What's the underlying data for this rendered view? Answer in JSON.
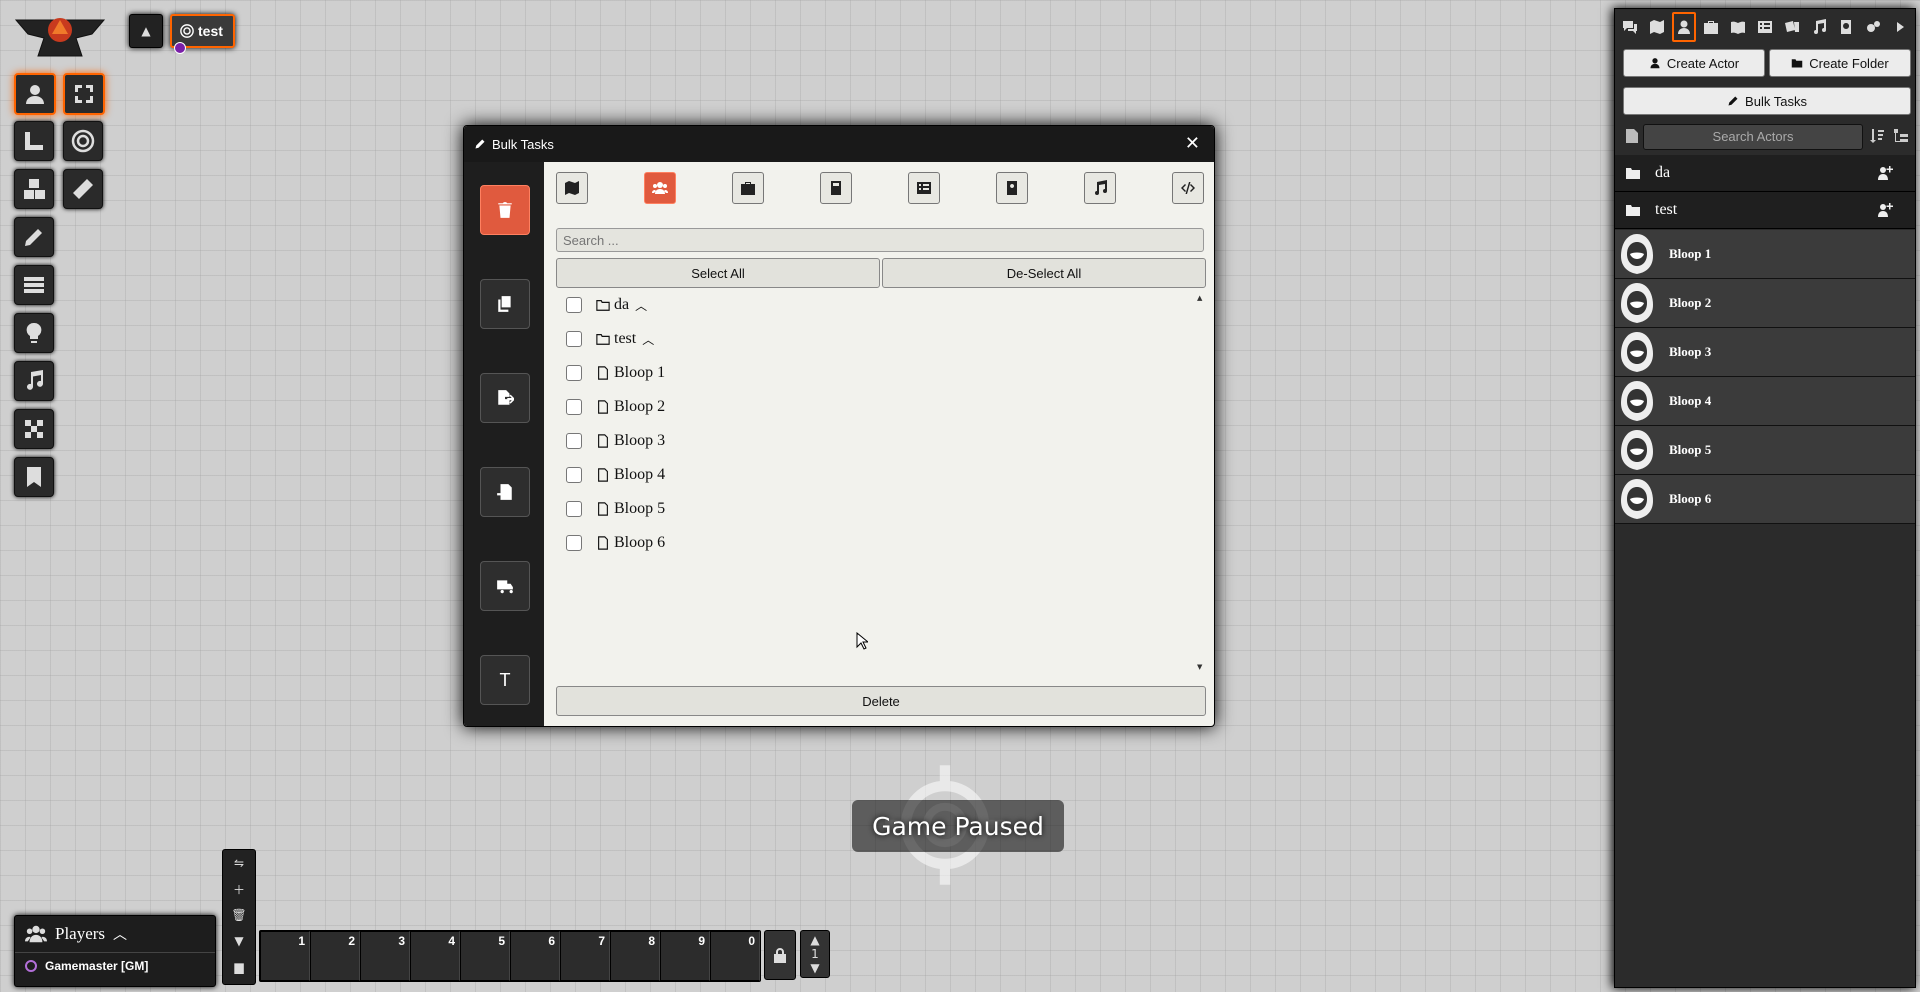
{
  "scene": {
    "name": "test"
  },
  "bulk": {
    "title": "Bulk Tasks",
    "search_placeholder": "Search ...",
    "select_all": "Select All",
    "deselect_all": "De-Select All",
    "delete": "Delete",
    "side_text_button": "T",
    "items": [
      {
        "label": "da",
        "kind": "folder"
      },
      {
        "label": "test",
        "kind": "folder"
      },
      {
        "label": "Bloop 1",
        "kind": "document"
      },
      {
        "label": "Bloop 2",
        "kind": "document"
      },
      {
        "label": "Bloop 3",
        "kind": "document"
      },
      {
        "label": "Bloop 4",
        "kind": "document"
      },
      {
        "label": "Bloop 5",
        "kind": "document"
      },
      {
        "label": "Bloop 6",
        "kind": "document"
      }
    ]
  },
  "sidebar": {
    "create_actor": "Create Actor",
    "create_folder": "Create Folder",
    "bulk_tasks": "Bulk Tasks",
    "search_placeholder": "Search Actors",
    "folders": [
      "da",
      "test"
    ],
    "actors": [
      "Bloop 1",
      "Bloop 2",
      "Bloop 3",
      "Bloop 4",
      "Bloop 5",
      "Bloop 6"
    ]
  },
  "players": {
    "title": "Players",
    "user": "Gamemaster [GM]"
  },
  "hotbar": {
    "slots": [
      "1",
      "2",
      "3",
      "4",
      "5",
      "6",
      "7",
      "8",
      "9",
      "0"
    ],
    "page": "1"
  },
  "paused": {
    "label": "Game Paused"
  },
  "colors": {
    "accent": "#ff6400",
    "active_button": "#e05a3e"
  }
}
